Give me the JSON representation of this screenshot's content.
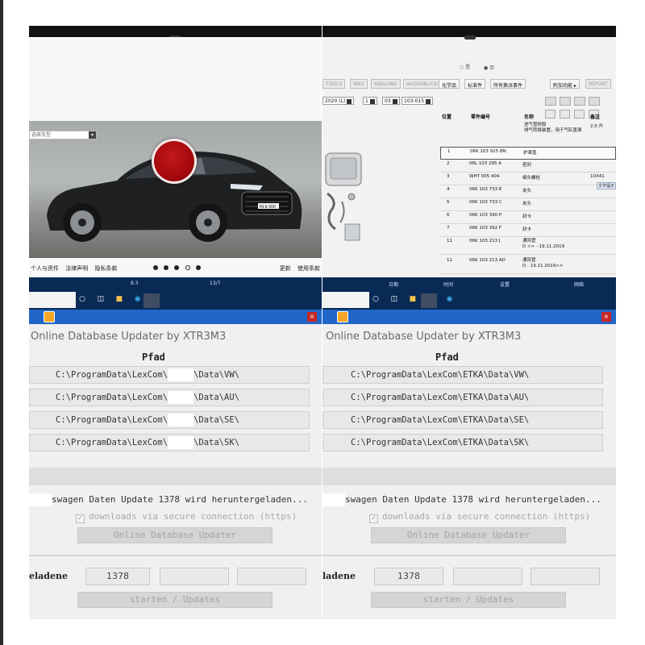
{
  "top_left": {
    "select_text": "选择车型",
    "plate": "IN·E 000",
    "footer_links": [
      "个人与资件",
      "法律声明",
      "隐私条款"
    ],
    "footer_right": [
      "更新",
      "使用条款"
    ],
    "carousel_active_index": 3,
    "carousel_count": 5
  },
  "top_right": {
    "radios": [
      "○ 是",
      "● 否"
    ],
    "tabs": [
      "TOOLS",
      "WAS",
      "ABSLUNG",
      "AUGENBLICK",
      "化学品",
      "标准件",
      "所有换派事件",
      "附加功能 ▸",
      "REPORT"
    ],
    "fields": [
      "2020 (L)",
      "1",
      "03",
      "103-015"
    ],
    "table_headers": [
      "位置",
      "零件编号",
      "名称",
      "备注"
    ],
    "top_note": {
      "name": "进气管桥股\n排气转换装置，用于气缸盖罩",
      "remark": "2.0 升"
    },
    "rows": [
      {
        "pos": "1",
        "part": "06K 103 925 BN",
        "name": "护罩盖",
        "note": ""
      },
      {
        "pos": "2",
        "part": "06L 103 295 A",
        "name": "密封",
        "note": ""
      },
      {
        "pos": "3",
        "part": "WHT 005 404",
        "name": "细头螺栓",
        "note": "10X41"
      },
      {
        "pos": "4",
        "part": "06K 103 733 E",
        "name": "夹头",
        "note": ""
      },
      {
        "pos": "5",
        "part": "06K 103 733 C",
        "name": "夹头",
        "note": ""
      },
      {
        "pos": "6",
        "part": "06K 103 390 P",
        "name": "封卡",
        "note": ""
      },
      {
        "pos": "7",
        "part": "06K 103 392 F",
        "name": "封卡",
        "note": ""
      },
      {
        "pos": "11",
        "part": "06K 103 213 J",
        "name": "通风管\nD        >> - 19.11.2019",
        "note": ""
      },
      {
        "pos": "11",
        "part": "06K 103 213 AD",
        "name": "通风管\nD - 19.11.2019>>",
        "note": ""
      }
    ],
    "side_hint": "文字提示"
  },
  "taskbar": {
    "left_mini": [
      "8.3",
      "13/7"
    ],
    "right_mini": [
      "日期",
      "时间",
      "设置",
      "网络"
    ]
  },
  "updater_left": {
    "title": "Online Database Updater by XTR3M3",
    "header": "Pfad",
    "paths": [
      {
        "pre": "C:\\ProgramData\\LexCom\\",
        "post": "\\Data\\VW\\"
      },
      {
        "pre": "C:\\ProgramData\\LexCom\\",
        "post": "\\Data\\AU\\"
      },
      {
        "pre": "C:\\ProgramData\\LexCom\\",
        "post": "\\Data\\SE\\"
      },
      {
        "pre": "C:\\ProgramData\\LexCom\\",
        "post": "\\Data\\SK\\"
      }
    ],
    "status": "swagen Daten Update 1378 wird heruntergeladen...",
    "checkbox_label": "downloads via secure connection (https)",
    "online_button": "Online Database Updater",
    "field_label": "eladene",
    "field_value": "1378",
    "start_button": "starten / Updates"
  },
  "updater_right": {
    "title": "Online Database Updater by XTR3M3",
    "header": "Pfad",
    "paths": [
      "C:\\ProgramData\\LexCom\\ETKA\\Data\\VW\\",
      "C:\\ProgramData\\LexCom\\ETKA\\Data\\AU\\",
      "C:\\ProgramData\\LexCom\\ETKA\\Data\\SE\\",
      "C:\\ProgramData\\LexCom\\ETKA\\Data\\SK\\"
    ],
    "status": "swagen Daten Update 1378 wird heruntergeladen...",
    "checkbox_label": "downloads via secure connection (https)",
    "online_button": "Online Database Updater",
    "field_label": "ladene",
    "field_value": "1378",
    "start_button": "starten / Updates"
  },
  "colors": {
    "taskbar": "#0a2a56",
    "window_titlebar": "#1f66c6",
    "accent_red": "#a5080c",
    "car_body": "#1e2022"
  },
  "icons": [
    "search-icon",
    "task-view-icon",
    "file-explorer-icon",
    "edge-icon",
    "app-icon",
    "close-icon",
    "checkbox-icon"
  ]
}
